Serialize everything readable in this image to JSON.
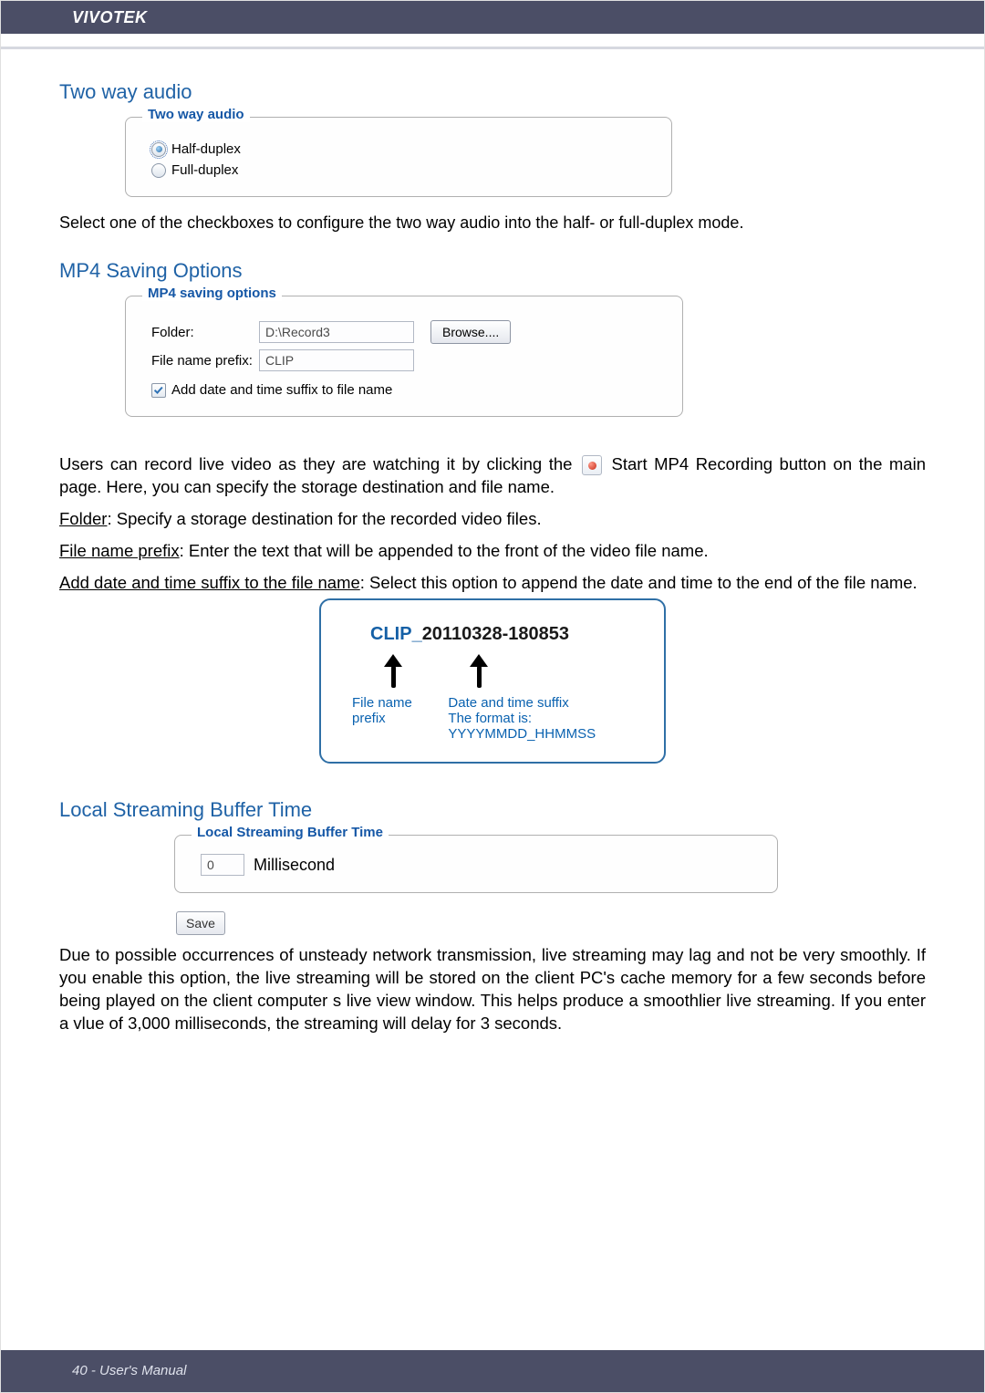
{
  "header": {
    "brand": "VIVOTEK"
  },
  "sections": {
    "twoway": {
      "title": "Two way audio",
      "legend": "Two way audio",
      "opt_half": "Half-duplex",
      "opt_full": "Full-duplex",
      "selected": "half",
      "desc": "Select one of the checkboxes to configure the two way audio into the half- or full-duplex mode."
    },
    "mp4": {
      "title": "MP4 Saving Options",
      "legend": "MP4 saving options",
      "folder_label": "Folder:",
      "folder_value": "D:\\Record3",
      "browse": "Browse....",
      "prefix_label": "File name prefix:",
      "prefix_value": "CLIP",
      "checkbox_label": "Add date and time suffix to file name",
      "checkbox_checked": true,
      "para_a": "Users can record live video as they are watching it by clicking the ",
      "para_b": "  Start MP4 Recording  button on the main page. Here, you can specify the storage destination and file name.",
      "folder_desc_u": "Folder",
      "folder_desc_t": ": Specify a storage destination for the recorded video files.",
      "prefix_desc_u": "File name prefix",
      "prefix_desc_t": ": Enter the text that will be appended to the front of the video file name.",
      "suffix_desc_u": "Add date and time suffix to the file name",
      "suffix_desc_t": ": Select this option to append the date and time to the end of the file name.",
      "example": {
        "clip": "CLIP",
        "sep": "_",
        "date": "20110328-180853",
        "cap_prefix": "File name prefix",
        "cap_suffix_l1": "Date and time suffix",
        "cap_suffix_l2": "The format is: YYYYMMDD_HHMMSS"
      }
    },
    "buffer": {
      "title": "Local Streaming Buffer Time",
      "legend": "Local Streaming Buffer Time",
      "value": "0",
      "unit": "Millisecond",
      "save": "Save",
      "desc": "Due to possible occurrences of unsteady network transmission, live streaming may lag and not be very smoothly. If you enable this option, the live streaming will be stored on the client PC's cache memory for a few seconds before being played on the client computer s live view window. This helps produce a smoothlier live streaming. If you enter a vlue of 3,000 milliseconds, the streaming will delay for 3 seconds."
    }
  },
  "footer": {
    "text": "40 - User's Manual"
  }
}
